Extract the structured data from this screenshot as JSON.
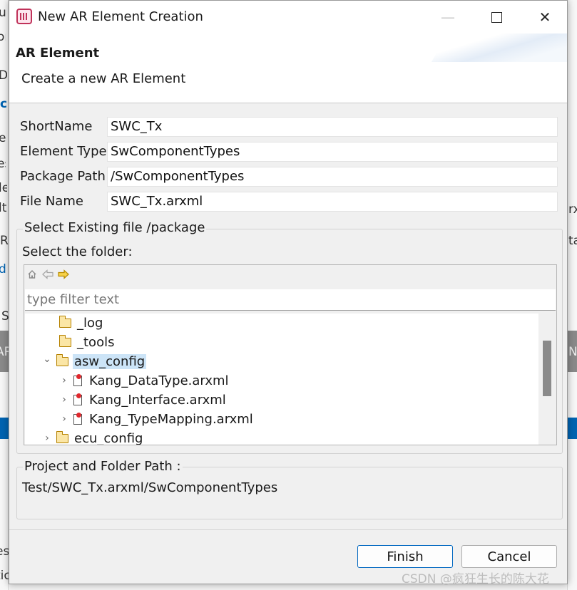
{
  "background": {
    "left_fragments": [
      "u",
      "or",
      "Di",
      "c",
      "e",
      "es",
      "le",
      "lt",
      "R",
      "d",
      "S",
      "AR",
      "es",
      "tic"
    ],
    "right_fragments": [
      "rx",
      "ta",
      "N"
    ]
  },
  "dialog": {
    "title": "New AR Element Creation",
    "window_controls": {
      "minimize": "—",
      "close": "✕"
    },
    "header": {
      "section_title": "AR Element",
      "description": "Create a new AR Element"
    },
    "form": {
      "short_name": {
        "label": "ShortName",
        "value": "SWC_Tx"
      },
      "element_type": {
        "label": "Element Type",
        "value": "SwComponentTypes"
      },
      "package_path": {
        "label": "Package Path",
        "value": "/SwComponentTypes"
      },
      "file_name": {
        "label": "File Name",
        "value": "SWC_Tx.arxml"
      }
    },
    "select_group": {
      "legend": "Select Existing file /package",
      "folder_label": "Select the folder:",
      "nav_icons": [
        "home-icon",
        "back-arrow-icon",
        "forward-arrow-icon"
      ],
      "filter": {
        "placeholder": "type filter text",
        "value": ""
      },
      "tree": [
        {
          "label": "_log",
          "type": "folder",
          "expanded": null
        },
        {
          "label": "_tools",
          "type": "folder",
          "expanded": null
        },
        {
          "label": "asw_config",
          "type": "folder",
          "expanded": true,
          "selected": true
        },
        {
          "label": "Kang_DataType.arxml",
          "type": "arxml-file",
          "expanded": false
        },
        {
          "label": "Kang_Interface.arxml",
          "type": "arxml-file",
          "expanded": false
        },
        {
          "label": "Kang_TypeMapping.arxml",
          "type": "arxml-file",
          "expanded": false
        },
        {
          "label": "ecu_config",
          "type": "folder",
          "expanded": false
        }
      ],
      "chevrons": {
        "expanded": "⌄",
        "collapsed": "›"
      }
    },
    "path_group": {
      "legend": "Project and Folder Path :",
      "value": "Test/SWC_Tx.arxml/SwComponentTypes"
    },
    "buttons": {
      "finish": "Finish",
      "cancel": "Cancel"
    }
  },
  "watermark": "CSDN @疯狂生长的陈大花",
  "colors": {
    "selection": "#cce4f7",
    "primary_button_border": "#0067c0",
    "background_accent": "#0063b1"
  }
}
